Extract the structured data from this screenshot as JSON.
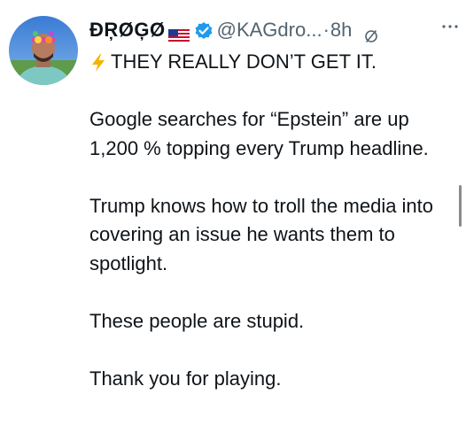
{
  "tweet": {
    "display_name": "ĐŖØĢØ",
    "handle": "@KAGdro...",
    "separator": "·",
    "time": "8h",
    "icons": {
      "flag": "us-flag-icon",
      "verified": "verified-badge-icon",
      "grok": "grok-icon",
      "more": "more-icon",
      "bolt": "lightning-bolt-icon"
    },
    "colors": {
      "verified": "#1d9bf0",
      "bolt": "#f4b400",
      "text": "#0f1419",
      "secondary": "#536471"
    },
    "lead": "THEY REALLY DON’T GET IT.",
    "paragraphs": [
      "Google searches for “Epstein” are up 1,200 % topping every Trump headline.",
      "Trump knows how to troll the media into covering an issue he wants them to spotlight.",
      "These people are stupid.",
      "Thank you for playing."
    ]
  }
}
